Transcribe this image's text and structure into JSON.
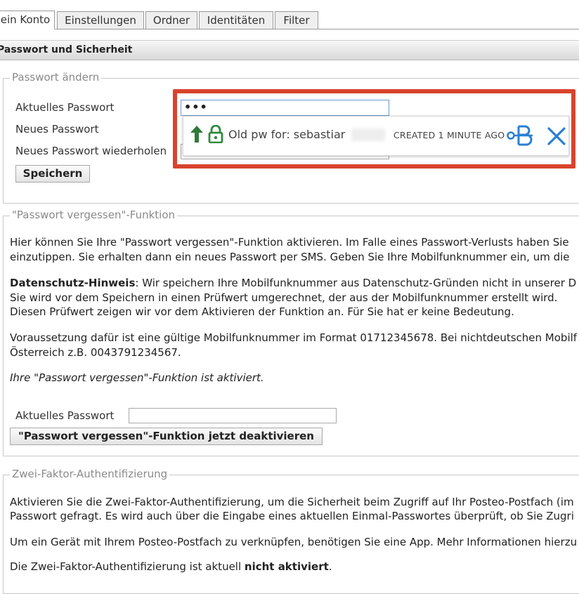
{
  "tabs": [
    {
      "label": "ein Konto",
      "active": true
    },
    {
      "label": "Einstellungen",
      "active": false
    },
    {
      "label": "Ordner",
      "active": false
    },
    {
      "label": "Identitäten",
      "active": false
    },
    {
      "label": "Filter",
      "active": false
    }
  ],
  "section_title": "Passwort und Sicherheit",
  "change_password": {
    "legend": "Passwort ändern",
    "current_label": "Aktuelles Passwort",
    "current_value": "•••",
    "new_label": "Neues Passwort",
    "repeat_label": "Neues Passwort wiederholen",
    "save_label": "Speichern"
  },
  "autofill": {
    "entry_text": "Old pw for: sebastiar",
    "created": "CREATED 1 MINUTE AGO",
    "accent_color": "#2a7fd4",
    "frame_color": "#d9432d"
  },
  "forgot": {
    "legend": "\"Passwort vergessen\"-Funktion",
    "p1_l1": "Hier können Sie Ihre \"Passwort vergessen\"-Funktion aktivieren. Im Falle eines Passwort-Verlusts haben Sie",
    "p1_l2": "einzutippen. Sie erhalten dann ein neues Passwort per SMS. Geben Sie Ihre Mobilfunknummer ein, um die",
    "p2_bold": "Datenschutz-Hinweis",
    "p2_l1": ": Wir speichern Ihre Mobilfunknummer aus Datenschutz-Gründen nicht in unserer D",
    "p2_l2": "Sie wird vor dem Speichern in einen Prüfwert umgerechnet, der aus der Mobilfunknummer erstellt wird.",
    "p2_l3": "Diesen Prüfwert zeigen wir vor dem Aktivieren der Funktion an. Für Sie hat er keine Bedeutung.",
    "p3_l1": "Voraussetzung dafür ist eine gültige Mobilfunknummer im Format 01712345678. Bei nichtdeutschen Mobilf",
    "p3_l2": "Österreich z.B. 0043791234567.",
    "status": "Ihre \"Passwort vergessen\"-Funktion ist aktiviert.",
    "current_label": "Aktuelles Passwort",
    "deactivate_label": "\"Passwort vergessen\"-Funktion jetzt deaktivieren"
  },
  "twofa": {
    "legend": "Zwei-Faktor-Authentifizierung",
    "p1_l1": "Aktivieren Sie die Zwei-Faktor-Authentifizierung, um die Sicherheit beim Zugriff auf Ihr Posteo-Postfach (im",
    "p1_l2": "Passwort gefragt. Es wird auch über die Eingabe eines aktuellen Einmal-Passwortes überprüft, ob Sie Zugri",
    "p2": "Um ein Gerät mit Ihrem Posteo-Postfach zu verknüpfen, benötigen Sie eine App. Mehr Informationen hierzu",
    "p3_pre": "Die Zwei-Faktor-Authentifizierung ist aktuell ",
    "p3_bold": "nicht aktiviert",
    "p3_post": "."
  }
}
